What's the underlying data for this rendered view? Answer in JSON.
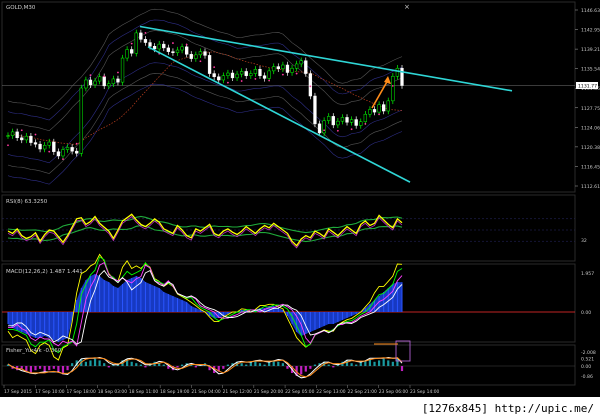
{
  "chart_data": [
    {
      "type": "line",
      "title": "GOLD,M30",
      "symbol": "GOLD",
      "timeframe": "M30",
      "y_ticks": [
        "1146.63",
        "1142.95",
        "1139.21",
        "1135.54",
        "1131.86",
        "1127.75",
        "1124.06",
        "1120.38",
        "1116.45",
        "1112.61"
      ],
      "ylim": [
        1112.61,
        1146.63
      ],
      "current_price": "1131.77",
      "close_series": [
        1122.4,
        1123.1,
        1122.0,
        1121.6,
        1122.3,
        1121.1,
        1120.8,
        1119.9,
        1120.6,
        1121.2,
        1119.4,
        1118.6,
        1119.8,
        1120.2,
        1119.5,
        1119.1,
        1131.3,
        1132.8,
        1131.9,
        1132.6,
        1133.4,
        1131.7,
        1132.1,
        1133.0,
        1132.4,
        1136.9,
        1138.5,
        1137.8,
        1141.6,
        1140.4,
        1139.8,
        1139.1,
        1138.6,
        1139.5,
        1138.8,
        1138.1,
        1137.9,
        1138.4,
        1139.0,
        1137.6,
        1136.8,
        1137.5,
        1138.1,
        1137.4,
        1134.0,
        1133.4,
        1132.8,
        1133.6,
        1134.1,
        1133.2,
        1133.9,
        1134.4,
        1133.6,
        1134.0,
        1134.8,
        1133.6,
        1133.1,
        1134.5,
        1135.3,
        1134.9,
        1135.6,
        1134.2,
        1135.0,
        1135.8,
        1136.4,
        1134.0,
        1129.8,
        1124.6,
        1122.9,
        1125.2,
        1126.0,
        1124.4,
        1125.1,
        1125.8,
        1124.9,
        1125.4,
        1124.3,
        1125.0,
        1126.4,
        1127.3,
        1126.8,
        1128.2,
        1127.0,
        1128.9,
        1133.5,
        1135.0,
        1131.77
      ],
      "channel_lines": [
        {
          "name": "upper-trendline",
          "from": [
            "17 Sep 15:00",
            1142.8
          ],
          "to": [
            "23 Sep 14:00",
            1131.9
          ]
        },
        {
          "name": "lower-trendline",
          "from": [
            "17 Sep 15:00",
            1139.0
          ],
          "to": [
            "23 Sep 14:00",
            1115.2
          ]
        }
      ]
    },
    {
      "type": "line",
      "title": "RSI(8) 63.3250",
      "y_ticks": [
        "32"
      ],
      "series": [
        {
          "name": "RSI(8)",
          "color": "#ffff00",
          "values": [
            48,
            44,
            52,
            40,
            35,
            38,
            45,
            30,
            42,
            50,
            48,
            38,
            28,
            40,
            55,
            70,
            72,
            60,
            65,
            74,
            62,
            55,
            48,
            35,
            50,
            66,
            72,
            78,
            68,
            60,
            56,
            62,
            70,
            64,
            52,
            48,
            44,
            58,
            50,
            40,
            36,
            52,
            48,
            54,
            60,
            44,
            40,
            48,
            52,
            46,
            42,
            48,
            56,
            50,
            44,
            52,
            58,
            54,
            62,
            56,
            50,
            44,
            30,
            22,
            34,
            40,
            36,
            48,
            44,
            38,
            52,
            46,
            40,
            48,
            56,
            50,
            44,
            60,
            66,
            58,
            62,
            76,
            68,
            60,
            54,
            70,
            63
          ]
        }
      ]
    },
    {
      "type": "area",
      "title": "MACD(12,26,2) 1.487 1.441",
      "y_ticks": [
        "1.957",
        "0.00",
        "-2.008"
      ],
      "series": [
        {
          "name": "MACD",
          "color": "#1a3fd6",
          "values": [
            -0.6,
            -0.8,
            -0.9,
            -1.0,
            -1.1,
            -1.2,
            -1.3,
            -1.3,
            -1.2,
            -1.3,
            -1.4,
            -1.5,
            -1.4,
            -1.3,
            -0.4,
            0.6,
            1.2,
            1.6,
            1.8,
            1.9,
            1.8,
            1.6,
            1.5,
            1.3,
            1.2,
            1.4,
            1.6,
            1.7,
            1.8,
            1.7,
            1.5,
            1.4,
            1.3,
            1.2,
            1.0,
            0.9,
            0.8,
            0.7,
            0.6,
            0.5,
            0.3,
            0.2,
            0.1,
            0.0,
            -0.2,
            -0.3,
            -0.3,
            -0.2,
            -0.1,
            0.0,
            0.0,
            0.1,
            0.1,
            0.0,
            0.1,
            0.2,
            0.2,
            0.3,
            0.3,
            0.2,
            0.1,
            -0.2,
            -0.6,
            -1.0,
            -1.2,
            -1.1,
            -1.0,
            -0.9,
            -0.8,
            -0.7,
            -0.6,
            -0.6,
            -0.5,
            -0.4,
            -0.3,
            -0.2,
            -0.1,
            0.0,
            0.2,
            0.4,
            0.6,
            0.8,
            1.0,
            1.2,
            1.4,
            1.5,
            1.49
          ]
        }
      ]
    },
    {
      "type": "bar",
      "title": "Fisher_Yur4ik -0.360",
      "y_ticks": [
        "0.521",
        "0.00",
        "-0.86"
      ],
      "series": [
        {
          "name": "Fisher",
          "values": [
            0.1,
            -0.2,
            -0.3,
            -0.2,
            -0.4,
            -0.5,
            -0.3,
            -0.2,
            -0.4,
            -0.3,
            -0.2,
            -0.4,
            -0.6,
            -0.3,
            0.2,
            0.4,
            0.5,
            0.3,
            0.4,
            0.5,
            0.4,
            0.2,
            -0.1,
            0.1,
            0.2,
            0.4,
            0.5,
            0.3,
            0.2,
            0.1,
            -0.1,
            0.2,
            0.3,
            0.2,
            0.1,
            -0.2,
            -0.3,
            -0.1,
            0.1,
            0.2,
            0.1,
            -0.1,
            0.1,
            0.2,
            -0.3,
            -0.5,
            -0.4,
            -0.2,
            0.1,
            0.2,
            0.3,
            0.2,
            0.1,
            0.3,
            0.4,
            0.2,
            0.1,
            0.3,
            0.4,
            0.3,
            0.2,
            -0.2,
            -0.5,
            -0.7,
            -0.6,
            -0.4,
            -0.2,
            0.1,
            0.2,
            0.3,
            0.1,
            -0.1,
            0.2,
            0.3,
            0.4,
            0.2,
            0.1,
            0.3,
            0.4,
            0.5,
            0.3,
            0.4,
            0.5,
            0.4,
            0.3,
            0.5,
            -0.36
          ]
        }
      ]
    }
  ],
  "x_labels": [
    "17 Sep 2015",
    "17 Sep 10:00",
    "17 Sep 18:00",
    "18 Sep 03:00",
    "18 Sep 11:00",
    "18 Sep 19:00",
    "21 Sep 04:00",
    "21 Sep 12:00",
    "21 Sep 20:00",
    "22 Sep 05:00",
    "22 Sep 13:00",
    "22 Sep 21:00",
    "23 Sep 06:00",
    "23 Sep 14:00"
  ],
  "colors": {
    "background": "#000000",
    "bull_candle": "#00ff00",
    "bear_candle": "#ffffff",
    "trendline": "#2fd6d6",
    "arrow": "#ff8c1a",
    "rsi": "#ffff00",
    "macd_fill": "#1a3fd6"
  },
  "footer_text": "[1276x845] http://upic.me/"
}
